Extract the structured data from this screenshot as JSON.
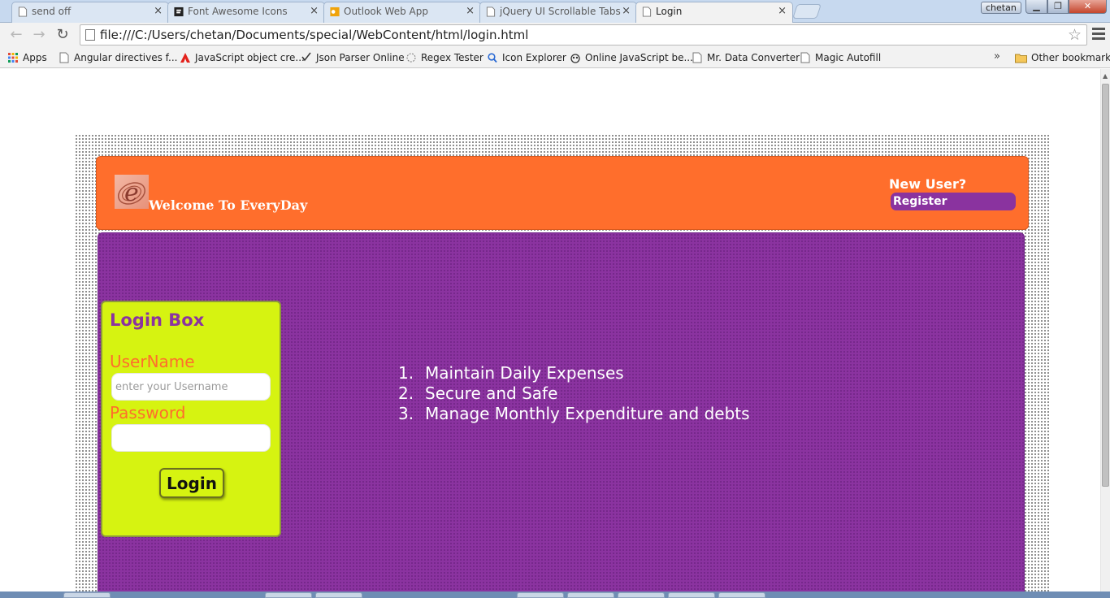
{
  "browser": {
    "tabs": [
      {
        "title": "send off",
        "active": false,
        "icon": "page-icon"
      },
      {
        "title": "Font Awesome Icons",
        "active": false,
        "icon": "font-awesome-icon"
      },
      {
        "title": "Outlook Web App",
        "active": false,
        "icon": "outlook-icon"
      },
      {
        "title": "jQuery UI Scrollable Tabs",
        "active": false,
        "icon": "page-icon"
      },
      {
        "title": "Login",
        "active": true,
        "icon": "page-icon"
      }
    ],
    "close_glyph": "×",
    "user_badge": "chetan",
    "window_buttons": {
      "minimize": "▁",
      "maximize": "❐",
      "close": "✕"
    },
    "nav": {
      "back": "←",
      "forward": "→",
      "reload": "↻"
    },
    "address": "file:///C:/Users/chetan/Documents/special/WebContent/html/login.html",
    "star_glyph": "☆",
    "bookmarks": [
      {
        "label": "Apps",
        "icon": "apps-grid-icon"
      },
      {
        "label": "Angular directives f...",
        "icon": "page-icon"
      },
      {
        "label": "JavaScript object cre...",
        "icon": "adobe-icon"
      },
      {
        "label": "Json Parser Online",
        "icon": "json-icon"
      },
      {
        "label": "Regex Tester",
        "icon": "regex-icon"
      },
      {
        "label": "Icon Explorer",
        "icon": "magnifier-icon"
      },
      {
        "label": "Online JavaScript be...",
        "icon": "owl-icon"
      },
      {
        "label": "Mr. Data Converter",
        "icon": "page-icon"
      },
      {
        "label": "Magic Autofill",
        "icon": "page-icon"
      }
    ],
    "bookmarks_overflow": "»",
    "other_bookmarks": "Other bookmarks"
  },
  "page": {
    "header": {
      "welcome": "Welcome To EveryDay",
      "new_user": "New User?",
      "register": "Register",
      "logo_letter": "e"
    },
    "login_box": {
      "title": "Login Box",
      "username_label": "UserName",
      "username_placeholder": "enter your Username",
      "password_label": "Password",
      "login_button": "Login"
    },
    "features": [
      {
        "num": "1.",
        "text": "Maintain Daily Expenses"
      },
      {
        "num": "2.",
        "text": "Secure and Safe"
      },
      {
        "num": "3.",
        "text": "Manage Monthly Expenditure and debts"
      }
    ]
  },
  "colors": {
    "header_orange": "#ff6e2c",
    "panel_purple": "#8b33a0",
    "login_lime": "#d6f311"
  }
}
